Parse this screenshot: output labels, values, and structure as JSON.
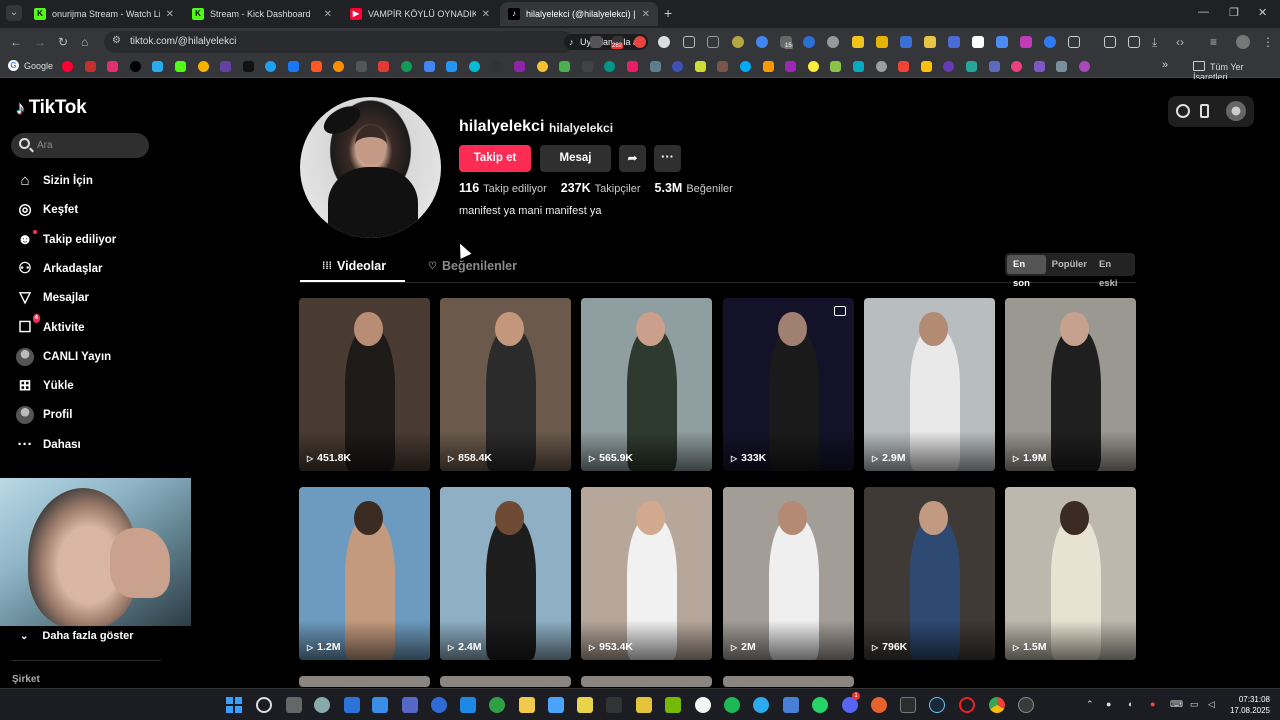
{
  "browser": {
    "tabs": [
      {
        "title": "onurijma Stream - Watch Live o",
        "favicon": "kick-icon",
        "active": false
      },
      {
        "title": "Stream - Kick Dashboard",
        "favicon": "kick-icon",
        "active": false
      },
      {
        "title": "VAMPİR KÖYLÜ OYNADIK! w/@",
        "favicon": "youtube-icon",
        "active": false
      },
      {
        "title": "hilalyelekci (@hilalyelekci) | Tik",
        "favicon": "tiktok-icon",
        "active": true
      }
    ],
    "url": "tiktok.com/@hilalyelekci",
    "open_in_app": "Uygulamada aç",
    "extension_badges": [
      "282",
      "15"
    ],
    "bookmarks": {
      "first": "Google",
      "all": "Tüm Yer İşaretleri"
    }
  },
  "sidebar": {
    "logo": "TikTok",
    "search_placeholder": "Ara",
    "items": [
      {
        "label": "Sizin İçin",
        "icon": "home-icon"
      },
      {
        "label": "Keşfet",
        "icon": "compass-icon"
      },
      {
        "label": "Takip ediliyor",
        "icon": "following-icon"
      },
      {
        "label": "Arkadaşlar",
        "icon": "friends-icon"
      },
      {
        "label": "Mesajlar",
        "icon": "messages-icon"
      },
      {
        "label": "Aktivite",
        "icon": "activity-icon",
        "badge": "4"
      },
      {
        "label": "CANLI Yayın",
        "icon": "live-avatar"
      },
      {
        "label": "Yükle",
        "icon": "upload-icon"
      },
      {
        "label": "Profil",
        "icon": "profile-icon"
      },
      {
        "label": "Dahası",
        "icon": "more-icon"
      }
    ],
    "show_more": "Daha fazla göster",
    "company": "Şirket"
  },
  "profile": {
    "username": "hilalyelekci",
    "nickname": "hilalyelekci",
    "follow_label": "Takip et",
    "message_label": "Mesaj",
    "stats": {
      "following_count": "116",
      "following_label": "Takip ediliyor",
      "followers_count": "237K",
      "followers_label": "Takipçiler",
      "likes_count": "5.3M",
      "likes_label": "Beğeniler"
    },
    "bio": "manifest ya mani manifest ya"
  },
  "content_tabs": {
    "videos": "Videolar",
    "liked": "Beğenilenler"
  },
  "sort": {
    "options": [
      "En son",
      "Popüler",
      "En eski"
    ],
    "selected": "En son"
  },
  "videos": [
    {
      "views": "451.8K",
      "bg": "#4a3b32",
      "fig": "#1e1a18",
      "head": "#b98c74"
    },
    {
      "views": "858.4K",
      "bg": "#6b5a4c",
      "fig": "#2b2b2b",
      "head": "#c4967c"
    },
    {
      "views": "565.9K",
      "bg": "#8f9ea0",
      "fig": "#2f3a2e",
      "head": "#caa08c"
    },
    {
      "views": "333K",
      "bg": "#141229",
      "fig": "#1a1a1a",
      "head": "#a08070"
    },
    {
      "views": "2.9M",
      "bg": "#b8bdbf",
      "fig": "#e9e9e9",
      "head": "#b38a72"
    },
    {
      "views": "1.9M",
      "bg": "#9a9890",
      "fig": "#1f1f1f",
      "head": "#c6a28e"
    },
    {
      "views": "1.2M",
      "bg": "#6d9bbf",
      "fig": "#c49a7e",
      "head": "#3b2b22"
    },
    {
      "views": "2.4M",
      "bg": "#8fb0c4",
      "fig": "#1d1d1d",
      "head": "#6e4a35"
    },
    {
      "views": "953.4K",
      "bg": "#b7a79a",
      "fig": "#f1f1f1",
      "head": "#d1a98f"
    },
    {
      "views": "2M",
      "bg": "#a39d98",
      "fig": "#efefef",
      "head": "#b58a74"
    },
    {
      "views": "796K",
      "bg": "#3f3a36",
      "fig": "#2e4a72",
      "head": "#c29a82"
    },
    {
      "views": "1.5M",
      "bg": "#bdb8ad",
      "fig": "#e8e2d2",
      "head": "#3b2b22"
    }
  ],
  "taskbar": {
    "badges": [
      "1"
    ],
    "clock_time": "07:31:08",
    "clock_date": "17.08.2025"
  },
  "colors": {
    "accent": "#fe2c55",
    "background": "#000000",
    "button": "#2f2f2f"
  }
}
